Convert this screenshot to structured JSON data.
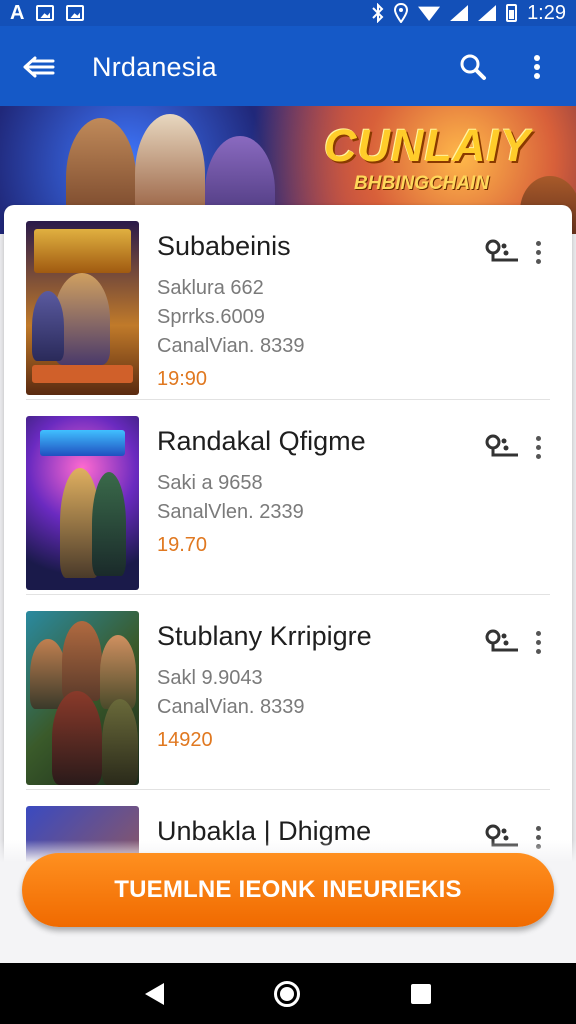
{
  "status_bar": {
    "app_letter": "A",
    "time": "1:29",
    "icons": [
      "font-icon",
      "image-icon",
      "cast-icon",
      "bluetooth-icon",
      "location-icon",
      "wifi-icon",
      "signal-icon",
      "signal-icon",
      "battery-icon"
    ]
  },
  "app_bar": {
    "title": "Nrdanesia",
    "icons": [
      "back-icon",
      "search-icon",
      "more-vert-icon"
    ],
    "color": "#1559c7"
  },
  "banner": {
    "title": "CUNLAIY",
    "subtitle": "BHBINGCHAIN"
  },
  "games": [
    {
      "title": "Subabeinis",
      "line1": "Saklura 662",
      "line2": "Sprrks.6009",
      "line3": "CanalVian. 8339",
      "price": "19:90",
      "icons": [
        "share-icon",
        "more-vert-icon"
      ]
    },
    {
      "title": "Randakal Qfigme",
      "line1": "Saki a 9658",
      "line2": "SanalVlen. 2339",
      "price": "19.70",
      "icons": [
        "share-icon",
        "more-vert-icon"
      ]
    },
    {
      "title": "Stublany Krripigre",
      "line1": "Sakl 9.9043",
      "line2": "CanalVian. 8339",
      "price": "14920",
      "icons": [
        "share-icon",
        "more-vert-icon"
      ]
    },
    {
      "title": "Unbakla | Dhigme",
      "icons": [
        "share-icon",
        "more-vert-icon"
      ]
    }
  ],
  "cta": {
    "label": "TUEMLNE IEONK INEURIEKIS",
    "color": "#f57c00"
  },
  "nav_bar": {
    "icons": [
      "nav-back-icon",
      "nav-home-icon",
      "nav-recents-icon"
    ]
  },
  "colors": {
    "primary": "#1559c7",
    "status_bar": "#1350b8",
    "accent": "#f57c00",
    "price": "#e07820"
  }
}
